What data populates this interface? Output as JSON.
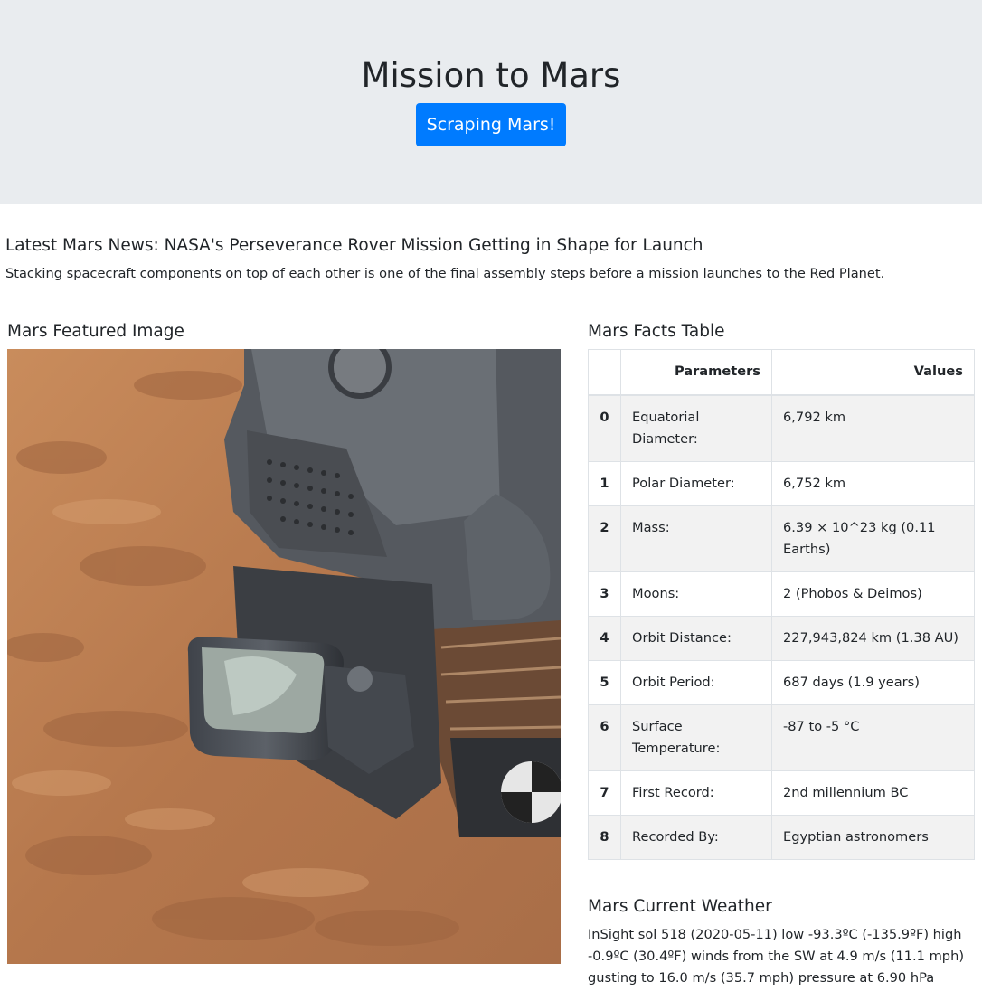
{
  "header": {
    "title": "Mission to Mars",
    "scrape_button_label": "Scraping Mars!"
  },
  "news": {
    "title": "Latest Mars News: NASA's Perseverance Rover Mission Getting in Shape for Launch",
    "teaser": "Stacking spacecraft components on top of each other is one of the final assembly steps before a mission launches to the Red Planet."
  },
  "featured_image": {
    "heading": "Mars Featured Image"
  },
  "facts": {
    "heading": "Mars Facts Table",
    "columns": [
      "",
      "Parameters",
      "Values"
    ],
    "rows": [
      {
        "index": "0",
        "parameter": "Equatorial Diameter:",
        "value": "6,792 km"
      },
      {
        "index": "1",
        "parameter": "Polar Diameter:",
        "value": "6,752 km"
      },
      {
        "index": "2",
        "parameter": "Mass:",
        "value": "6.39 × 10^23 kg (0.11 Earths)"
      },
      {
        "index": "3",
        "parameter": "Moons:",
        "value": "2 (Phobos & Deimos)"
      },
      {
        "index": "4",
        "parameter": "Orbit Distance:",
        "value": "227,943,824 km (1.38 AU)"
      },
      {
        "index": "5",
        "parameter": "Orbit Period:",
        "value": "687 days (1.9 years)"
      },
      {
        "index": "6",
        "parameter": "Surface Temperature:",
        "value": "-87 to -5 °C"
      },
      {
        "index": "7",
        "parameter": "First Record:",
        "value": "2nd millennium BC"
      },
      {
        "index": "8",
        "parameter": "Recorded By:",
        "value": "Egyptian astronomers"
      }
    ]
  },
  "weather": {
    "heading": "Mars Current Weather",
    "text": "InSight sol 518 (2020-05-11) low -93.3ºC (-135.9ºF) high -0.9ºC (30.4ºF) winds from the SW at 4.9 m/s (11.1 mph) gusting to 16.0 m/s (35.7 mph) pressure at 6.90 hPa"
  },
  "colors": {
    "jumbotron_bg": "#e9ecef",
    "button_primary": "#007bff",
    "mars_surface": "#b7784c"
  }
}
